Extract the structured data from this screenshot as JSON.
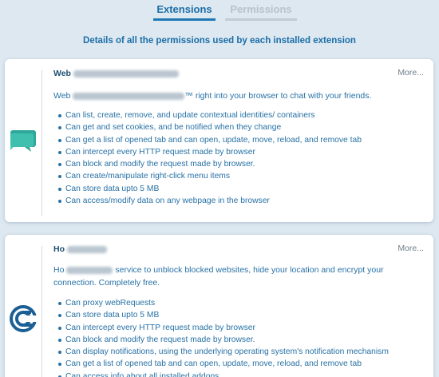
{
  "tabs": [
    {
      "label": "Extensions",
      "active": true
    },
    {
      "label": "Permissions",
      "active": false
    }
  ],
  "subtitle": "Details of all the permissions used by each installed extension",
  "colors": {
    "background": "#dde8f1",
    "accent": "#1f78b4",
    "text": "#2771a5",
    "inactive_tab": "#b7c2cb"
  },
  "extensions": [
    {
      "name": "Web",
      "more_label": "More...",
      "icon": "chat-bubble-icon",
      "description_start": "Web",
      "description_end": "™ right into your browser to chat with your friends.",
      "permissions": [
        "Can list, create, remove, and update contextual identities/ containers",
        "Can get and set cookies, and be notified when they change",
        "Can get a list of opened tab and can open, update, move, reload, and remove tab",
        "Can intercept every HTTP request made by browser",
        "Can block and modify the request made by browser.",
        "Can create/manipulate right-click menu items",
        "Can store data upto 5 MB",
        "Can access/modify data on any webpage in the browser"
      ]
    },
    {
      "name": "Ho",
      "more_label": "More...",
      "icon": "vpn-link-icon",
      "description_start": "Ho",
      "description_end": "service to unblock blocked websites, hide your location and encrypt your connection. Completely free.",
      "permissions": [
        "Can proxy webRequests",
        "Can store data upto 5 MB",
        "Can intercept every HTTP request made by browser",
        "Can block and modify the request made by browser.",
        "Can display notifications, using the underlying operating system's notification mechanism",
        "Can get a list of opened tab and can open, update, move, reload, and remove tab",
        "Can access info about all installed addons"
      ]
    }
  ]
}
